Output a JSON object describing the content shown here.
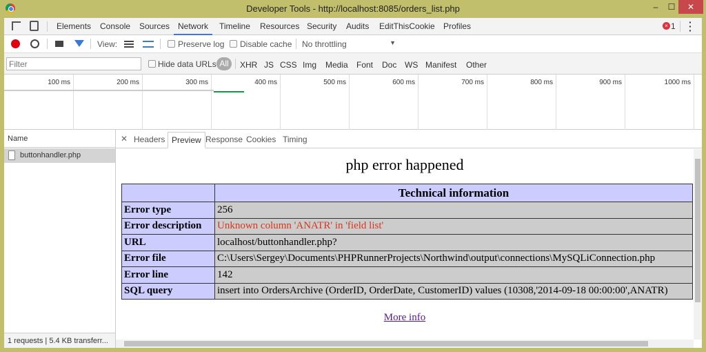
{
  "window": {
    "title": "Developer Tools - http://localhost:8085/orders_list.php",
    "minimize": "–",
    "maximize": "☐",
    "close": "✕"
  },
  "tabs": [
    "Elements",
    "Console",
    "Sources",
    "Network",
    "Timeline",
    "Resources",
    "Security",
    "Audits",
    "EditThisCookie",
    "Profiles"
  ],
  "error_count": "1",
  "toolbar": {
    "view_label": "View:",
    "preserve_log": "Preserve log",
    "disable_cache": "Disable cache",
    "throttling": "No throttling"
  },
  "filter": {
    "placeholder": "Filter",
    "hide_data_urls": "Hide data URLs",
    "types": [
      "All",
      "XHR",
      "JS",
      "CSS",
      "Img",
      "Media",
      "Font",
      "Doc",
      "WS",
      "Manifest",
      "Other"
    ]
  },
  "timeline": {
    "ticks": [
      "100 ms",
      "200 ms",
      "300 ms",
      "400 ms",
      "500 ms",
      "600 ms",
      "700 ms",
      "800 ms",
      "900 ms",
      "1000 ms"
    ]
  },
  "requests": {
    "header": "Name",
    "items": [
      "buttonhandler.php"
    ],
    "status": "1 requests | 5.4 KB transferr..."
  },
  "detail_tabs": [
    "Headers",
    "Preview",
    "Response",
    "Cookies",
    "Timing"
  ],
  "preview": {
    "heading": "php error happened",
    "table_header": "Technical information",
    "rows": [
      {
        "label": "Error type",
        "value": "256"
      },
      {
        "label": "Error description",
        "value": "Unknown column 'ANATR' in 'field list'"
      },
      {
        "label": "URL",
        "value": "localhost/buttonhandler.php?"
      },
      {
        "label": "Error file",
        "value": "C:\\Users\\Sergey\\Documents\\PHPRunnerProjects\\Northwind\\output\\connections\\MySQLiConnection.php"
      },
      {
        "label": "Error line",
        "value": "142"
      },
      {
        "label": "SQL query",
        "value": "insert into OrdersArchive (OrderID, OrderDate, CustomerID) values (10308,'2014-09-18 00:00:00',ANATR)"
      }
    ],
    "more_info": "More info"
  }
}
